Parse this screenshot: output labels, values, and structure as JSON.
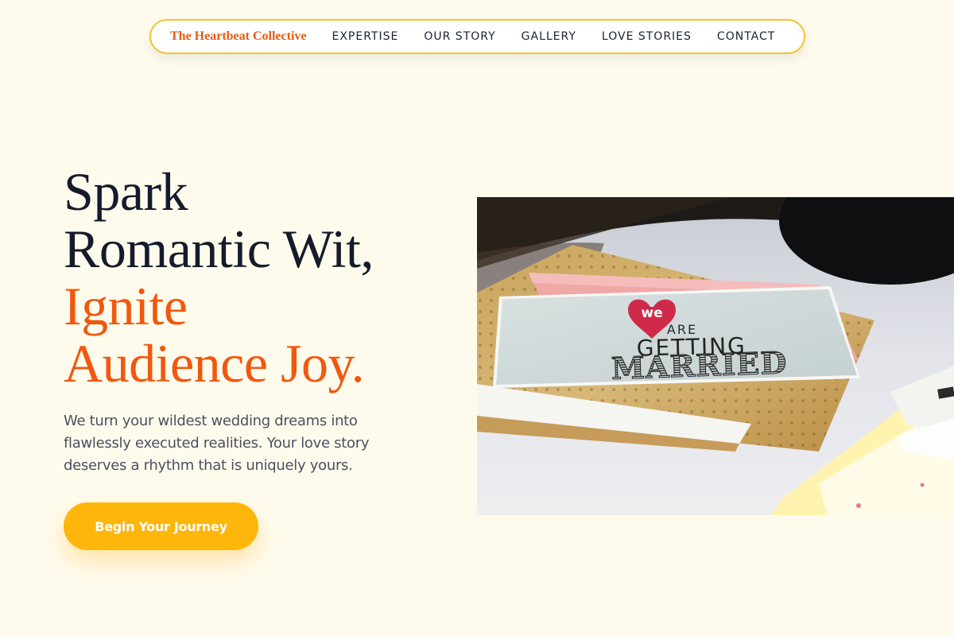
{
  "nav": {
    "brand": "The Heartbeat Collective",
    "links": [
      {
        "label": "EXPERTISE"
      },
      {
        "label": "OUR STORY"
      },
      {
        "label": "GALLERY"
      },
      {
        "label": "LOVE STORIES"
      },
      {
        "label": "CONTACT"
      }
    ]
  },
  "hero": {
    "headline_line1": "Spark",
    "headline_line2": "Romantic Wit,",
    "headline_line3": "Ignite",
    "headline_line4": "Audience Joy.",
    "subtext": "We turn your wildest wedding dreams into flawlessly executed realities. Your love story deserves a rhythm that is uniquely yours.",
    "cta_label": "Begin Your Journey",
    "image": {
      "card_heart_text": "we",
      "card_line1": "ARE",
      "card_line2": "GETTING",
      "card_line3": "MARRIED"
    }
  },
  "colors": {
    "background": "#FFFBEC",
    "accent": "#F0580F",
    "brand": "#E55A12",
    "cta": "#FFB60A",
    "nav_border": "#F2C330",
    "heading": "#141B2B"
  }
}
